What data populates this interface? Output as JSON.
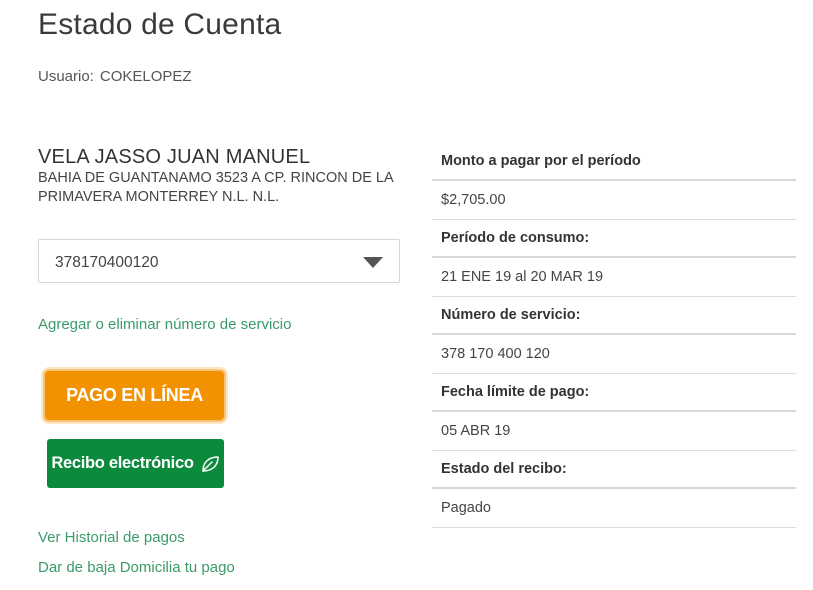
{
  "page": {
    "title": "Estado de Cuenta",
    "user_label": "Usuario:",
    "user_value": "COKELOPEZ"
  },
  "customer": {
    "name": "VELA JASSO JUAN MANUEL",
    "address": "BAHIA DE GUANTANAMO 3523 A CP. RINCON DE LA PRIMAVERA MONTERREY N.L. N.L."
  },
  "service_select": {
    "selected": "378170400120"
  },
  "links": {
    "manage_service": "Agregar o eliminar número de servicio",
    "payment_history": "Ver Historial de pagos",
    "unsubscribe": "Dar de baja Domicilia tu pago"
  },
  "buttons": {
    "pay_online": "PAGO EN LÍNEA",
    "electronic_receipt": "Recibo electrónico"
  },
  "summary": {
    "amount_label": "Monto a pagar por el período",
    "amount_value": "$2,705.00",
    "period_label": "Período de consumo:",
    "period_value": "21 ENE 19 al 20 MAR 19",
    "service_label": "Número de servicio:",
    "service_value": "378 170 400 120",
    "due_label": "Fecha límite de pago:",
    "due_value": "05 ABR 19",
    "status_label": "Estado del recibo:",
    "status_value": "Pagado"
  },
  "icons": {
    "select_arrow": "chevron-down-icon",
    "receipt": "leaf-icon"
  },
  "colors": {
    "link": "#3a9a6a",
    "pay_button": "#f39200",
    "receipt_button": "#0b8a3c"
  }
}
